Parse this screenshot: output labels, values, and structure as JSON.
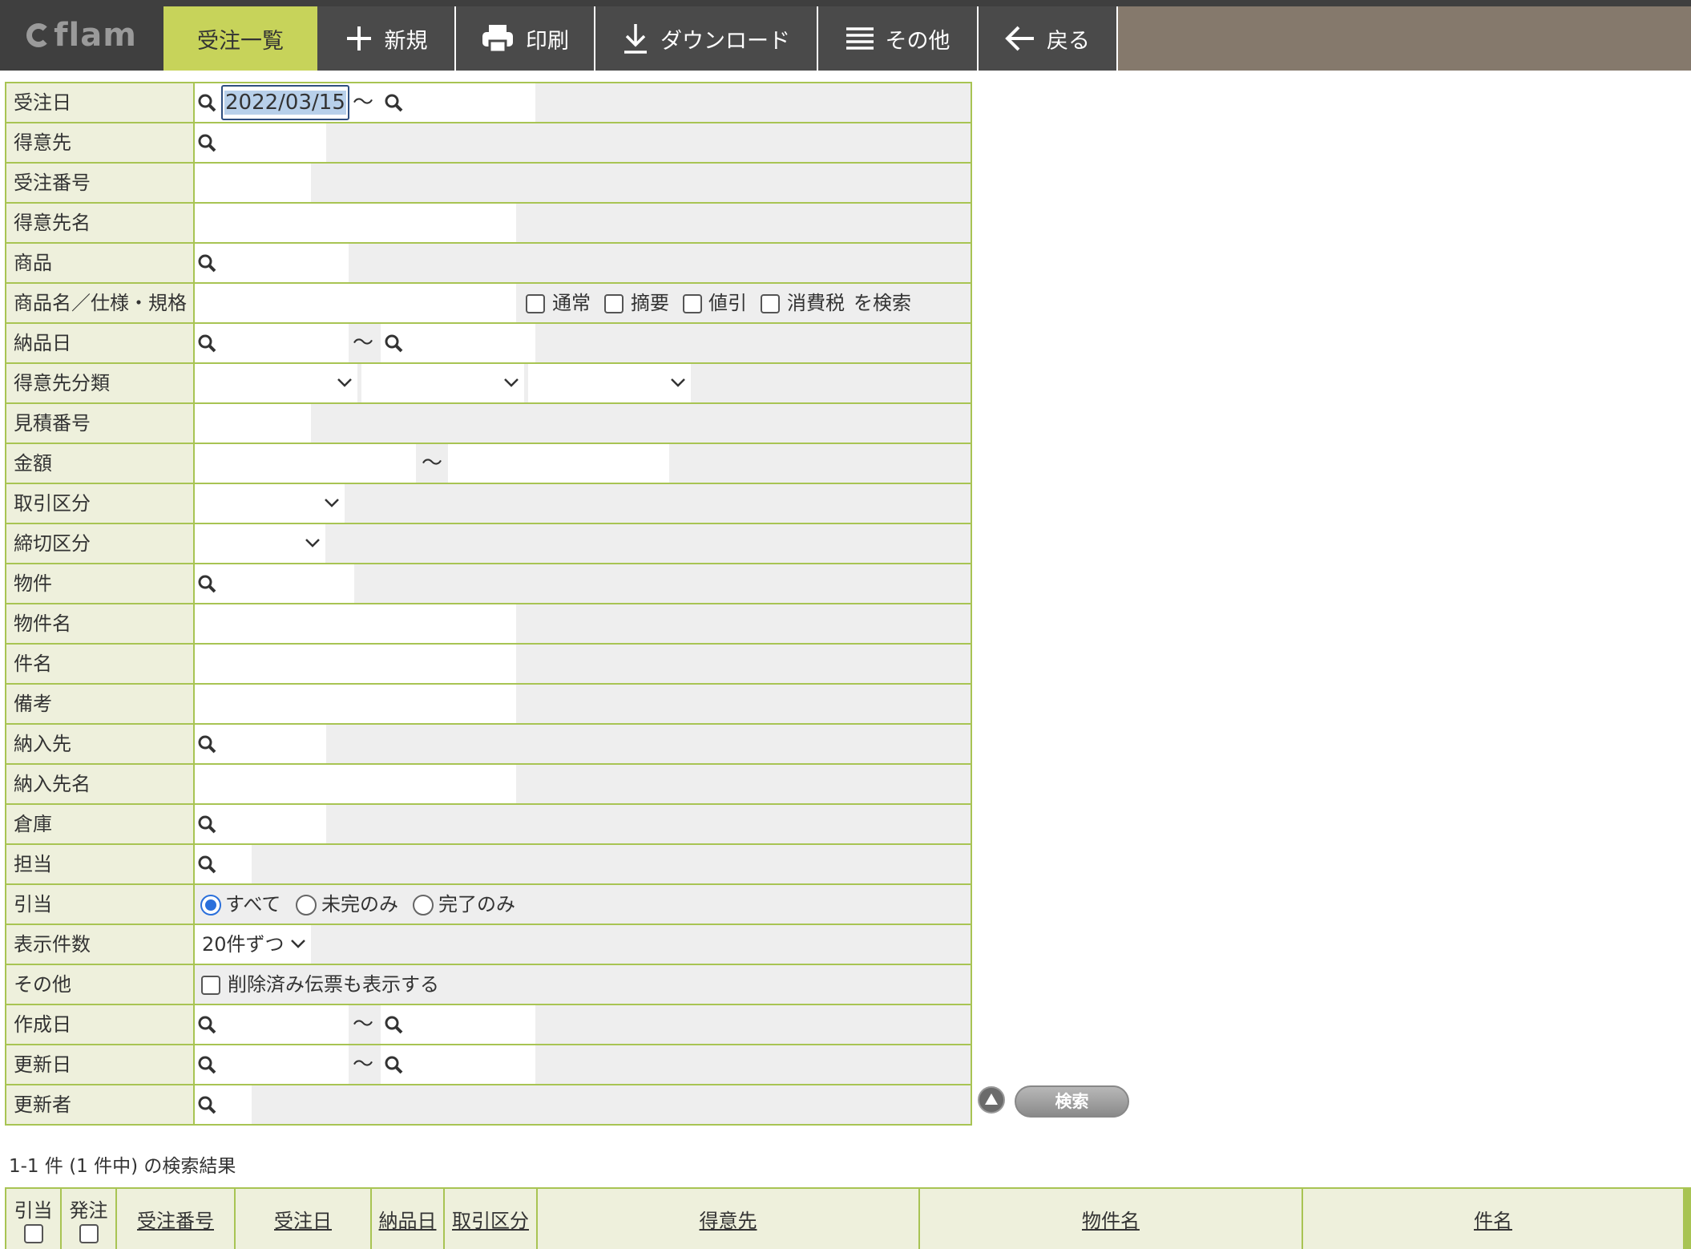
{
  "app": {
    "logo": "flam"
  },
  "nav": {
    "active_tab": "受注一覧",
    "new": "新規",
    "print": "印刷",
    "download": "ダウンロード",
    "more": "その他",
    "back": "戻る"
  },
  "form": {
    "labels": {
      "order_date": "受注日",
      "customer": "得意先",
      "order_no": "受注番号",
      "customer_name": "得意先名",
      "product": "商品",
      "product_spec": "商品名／仕様・規格",
      "delivery_date": "納品日",
      "customer_class": "得意先分類",
      "estimate_no": "見積番号",
      "amount": "金額",
      "trade_type": "取引区分",
      "closing_type": "締切区分",
      "property": "物件",
      "property_name": "物件名",
      "subject": "件名",
      "remarks": "備考",
      "ship_to": "納入先",
      "ship_to_name": "納入先名",
      "warehouse": "倉庫",
      "staff": "担当",
      "allocation": "引当",
      "page_size": "表示件数",
      "other": "その他",
      "created_date": "作成日",
      "updated_date": "更新日",
      "updated_by": "更新者"
    },
    "order_date_from": "2022/03/15",
    "tilde": "〜",
    "product_spec_options": {
      "normal": "通常",
      "summary": "摘要",
      "discount": "値引",
      "tax": "消費税",
      "suffix": "を検索"
    },
    "allocation_options": {
      "all": "すべて",
      "incomplete": "未完のみ",
      "complete": "完了のみ"
    },
    "page_size_value": "20件ずつ",
    "other_option": "削除済み伝票も表示する"
  },
  "search": {
    "button": "検索"
  },
  "results": {
    "count_text": "1-1 件 (1 件中) の検索結果",
    "columns": {
      "allocation": "引当",
      "order": "発注",
      "order_no": "受注番号",
      "order_date": "受注日",
      "delivery_date": "納品日",
      "trade_type": "取引区分",
      "customer": "得意先",
      "property_name": "物件名",
      "subject": "件名"
    }
  }
}
